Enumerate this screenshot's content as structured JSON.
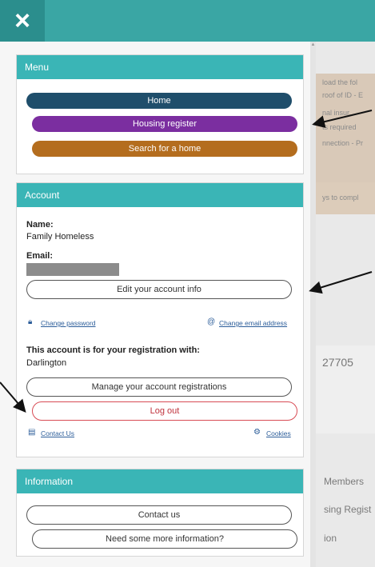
{
  "header": {
    "close_icon": "×"
  },
  "background_page": {
    "lines": [
      "load the fol",
      "roof of ID - E",
      "nal insur...",
      "ts required",
      "nnection - Pr",
      "ys to compl"
    ],
    "number": "27705",
    "labels": [
      "Members",
      "sing Regist",
      "ion"
    ]
  },
  "menu": {
    "title": "Menu",
    "items": [
      {
        "label": "Home",
        "color": "#1f4e6b"
      },
      {
        "label": "Housing register",
        "color": "#7b2ea0"
      },
      {
        "label": "Search for a home",
        "color": "#b46d1e"
      }
    ]
  },
  "account": {
    "title": "Account",
    "name_label": "Name:",
    "name_value": "Family Homeless",
    "email_label": "Email:",
    "edit_button": "Edit your account info",
    "change_password": "Change password",
    "change_email": "Change email address",
    "registration_heading": "This account is for your registration with:",
    "registration_value": "Darlington",
    "manage_button": "Manage your account registrations",
    "logout_button": "Log out",
    "contact_link": "Contact Us",
    "cookies_link": "Cookies"
  },
  "information": {
    "title": "Information",
    "contact_button": "Contact us",
    "more_info_button": "Need some more information?"
  },
  "colors": {
    "teal": "#3ab5b6",
    "topbar": "#3aa6a4",
    "logout": "#d84c55"
  }
}
